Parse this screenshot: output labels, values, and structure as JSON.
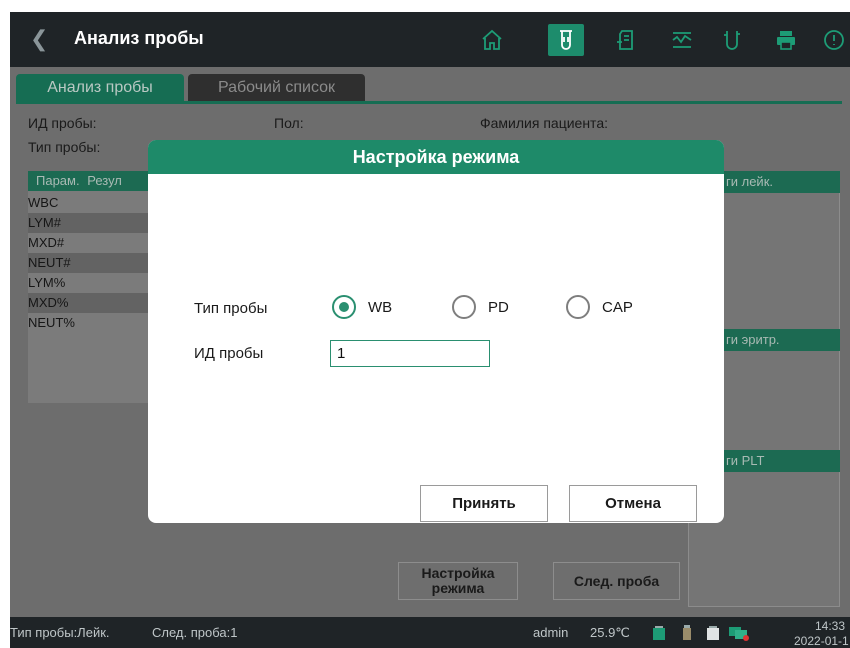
{
  "topbar": {
    "back_icon": "chevron-left-icon",
    "title": "Анализ пробы",
    "icons": [
      "home-icon",
      "test-tube-icon",
      "document-icon",
      "qc-chart-icon",
      "reagent-icon",
      "printer-icon",
      "alert-icon"
    ],
    "accent": "#1d8c6c"
  },
  "tabs": {
    "analysis": "Анализ пробы",
    "worklist": "Рабочий список"
  },
  "info": {
    "sample_id_label": "ИД пробы:",
    "gender_label": "Пол:",
    "patient_name_label": "Фамилия пациента:",
    "sample_type_label": "Тип пробы:"
  },
  "results_table": {
    "header_param": "Парам.",
    "header_result": "Резул",
    "params": [
      "WBC",
      "LYM#",
      "MXD#",
      "NEUT#",
      "LYM%",
      "MXD%",
      "NEUT%"
    ]
  },
  "right_panels": {
    "wbc_header": "ги лейк.",
    "rbc_header": "ги эритр.",
    "plt_header": "ги PLT"
  },
  "bottom_buttons": {
    "mode_setting": "Настройка режима",
    "next_sample": "След. проба"
  },
  "modal": {
    "title": "Настройка режима",
    "sample_type_label": "Тип пробы",
    "sample_type_options": [
      "WB",
      "PD",
      "CAP"
    ],
    "sample_type_selected": "WB",
    "sample_id_label": "ИД пробы",
    "sample_id_value": "1",
    "ok_label": "Принять",
    "cancel_label": "Отмена"
  },
  "statusbar": {
    "sample_type": "Тип пробы:Лейк.",
    "next_sample": "След. проба:1",
    "user": "admin",
    "temperature": "25.9℃",
    "time": "14:33",
    "date": "2022-01-1"
  }
}
